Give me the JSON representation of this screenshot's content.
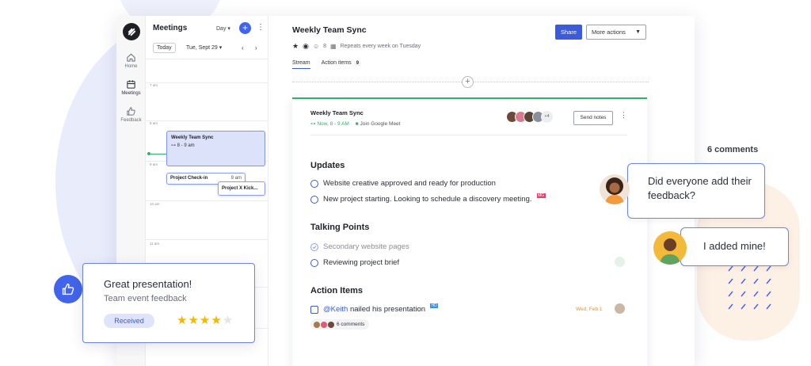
{
  "rail": {
    "items": [
      {
        "label": "Home",
        "icon": "home-icon"
      },
      {
        "label": "Meetings",
        "icon": "calendar-icon"
      },
      {
        "label": "Feedback",
        "icon": "thumbs-up-icon"
      }
    ]
  },
  "calendar": {
    "title": "Meetings",
    "view": "Day",
    "today": "Today",
    "date": "Tue, Sept 29",
    "hours": [
      "7 am",
      "8 am",
      "9 am",
      "10 am",
      "11 am"
    ],
    "events": [
      {
        "title": "Weekly Team Sync",
        "time": "8 - 9 am"
      },
      {
        "title": "Project Check-in",
        "time": "9 am"
      },
      {
        "title": "Project X Kick..."
      }
    ]
  },
  "meeting": {
    "title": "Weekly Team Sync",
    "viewer_count": "8",
    "repeat": "Repeats every week on Tuesday",
    "share": "Share",
    "more": "More actions",
    "tabs": {
      "stream": "Stream",
      "action_items": "Action items",
      "action_count": "9"
    }
  },
  "card": {
    "title": "Weekly Team Sync",
    "time": "Now, 8 - 9 AM",
    "join": "Join Google Meet",
    "attendee_more": "+4",
    "send_notes": "Send notes",
    "updates": {
      "heading": "Updates",
      "items": [
        "Website creative approved and ready for production",
        "New project starting. Looking to schedule a discovery meeting."
      ],
      "tag": "MG"
    },
    "talking": {
      "heading": "Talking Points",
      "items": [
        "Secondary website pages",
        "Reviewing project brief"
      ]
    },
    "actions": {
      "heading": "Action Items",
      "mention": "@Keith",
      "text": "nailed his presentation",
      "tag": "HD",
      "due": "Wed, Feb 1",
      "comments": "6 comments"
    }
  },
  "side": {
    "comments_label": "6 comments",
    "bubble1": "Did everyone add their feedback?",
    "bubble2": "I added mine!"
  },
  "feedback_card": {
    "title": "Great presentation!",
    "subtitle": "Team event feedback",
    "badge": "Received",
    "stars": "★★★★★",
    "rating": 4,
    "max_rating": 5
  },
  "colors": {
    "accent": "#3b5bdb",
    "live": "#2fb36b",
    "due": "#e8913b",
    "star": "#f5b800"
  }
}
